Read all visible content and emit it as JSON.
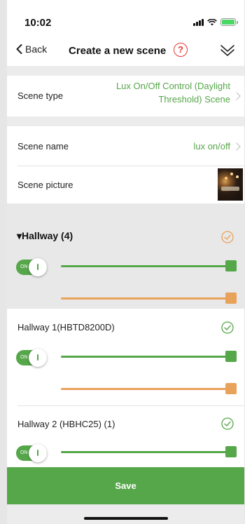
{
  "status_bar": {
    "time": "10:02"
  },
  "nav": {
    "back_label": "Back",
    "title": "Create a new scene",
    "help_symbol": "?"
  },
  "scene_type": {
    "label": "Scene type",
    "value": "Lux On/Off Control (Daylight Threshold) Scene"
  },
  "scene_name": {
    "label": "Scene name",
    "value": "lux on/off"
  },
  "scene_picture": {
    "label": "Scene picture"
  },
  "group": {
    "title": "▾Hallway (4)",
    "toggle_label": "ON",
    "check_color": "#e9a25a"
  },
  "devices": [
    {
      "name": "Hallway 1(HBTD8200D)",
      "toggle_label": "ON"
    },
    {
      "name": "Hallway 2 (HBHC25) (1)",
      "toggle_label": "ON"
    }
  ],
  "save_label": "Save",
  "colors": {
    "accent_green": "#56a64a",
    "accent_orange": "#e9a25a",
    "help_red": "#e53935"
  }
}
